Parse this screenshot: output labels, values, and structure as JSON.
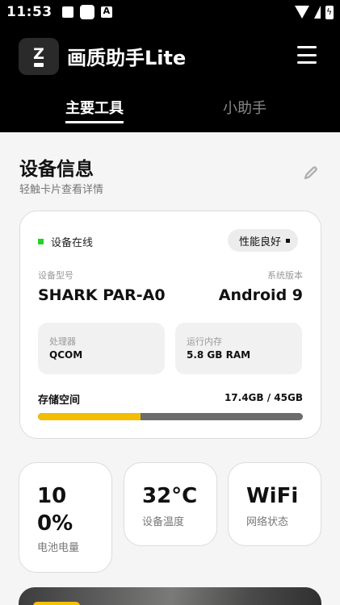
{
  "status_bar": {
    "time": "11:53"
  },
  "header": {
    "logo_letter": "Z",
    "app_title": "画质助手Lite",
    "tabs": [
      {
        "label": "主要工具",
        "active": true
      },
      {
        "label": "小助手",
        "active": false
      }
    ]
  },
  "device_section": {
    "title": "设备信息",
    "subtitle": "轻触卡片查看详情"
  },
  "device_card": {
    "online_status": "设备在线",
    "performance_badge": "性能良好",
    "model_label": "设备型号",
    "model_value": "SHARK PAR-A0",
    "system_label": "系统版本",
    "system_value": "Android 9",
    "cpu_label": "处理器",
    "cpu_value": "QCOM",
    "ram_label": "运行内存",
    "ram_value": "5.8 GB RAM",
    "storage_label": "存储空间",
    "storage_value": "17.4GB / 45GB",
    "storage_used_fraction": 0.387
  },
  "stats": {
    "battery_value": "100%",
    "battery_label": "电池电量",
    "temp_value": "32°C",
    "temp_label": "设备温度",
    "wifi_value": "WiFi",
    "wifi_label": "网络状态"
  },
  "colors": {
    "header_bg": "#000000",
    "online_dot": "#22d322",
    "storage_used": "#f5bd00",
    "storage_free": "#6c6c6c"
  }
}
